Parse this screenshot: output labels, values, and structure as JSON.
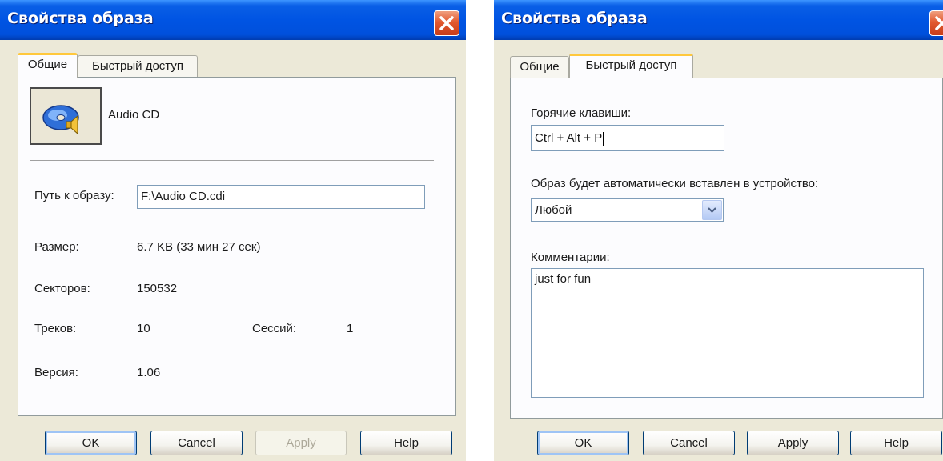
{
  "left_dialog": {
    "title": "Свойства образа",
    "tabs": [
      {
        "label": "Общие",
        "active": true
      },
      {
        "label": "Быстрый доступ",
        "active": false
      }
    ],
    "image_name": "Audio CD",
    "image_icon": "audio-cd-icon",
    "path_label": "Путь к образу:",
    "path_value": "F:\\Audio CD.cdi",
    "size_label": "Размер:",
    "size_value": "6.7 KB (33 мин 27 сек)",
    "sectors_label": "Секторов:",
    "sectors_value": "150532",
    "tracks_label": "Треков:",
    "tracks_value": "10",
    "sessions_label": "Сессий:",
    "sessions_value": "1",
    "version_label": "Версия:",
    "version_value": "1.06",
    "buttons": {
      "ok": "OK",
      "cancel": "Cancel",
      "apply": "Apply",
      "help": "Help"
    },
    "apply_enabled": false
  },
  "right_dialog": {
    "title": "Свойства образа",
    "tabs": [
      {
        "label": "Общие",
        "active": false
      },
      {
        "label": "Быстрый доступ",
        "active": true
      }
    ],
    "hotkey_label": "Горячие клавиши:",
    "hotkey_value": "Ctrl + Alt + P",
    "autoinsert_label": "Образ будет автоматически вставлен в устройство:",
    "autoinsert_selected": "Любой",
    "comments_label": "Комментарии:",
    "comments_value": "just for fun",
    "buttons": {
      "ok": "OK",
      "cancel": "Cancel",
      "apply": "Apply",
      "help": "Help"
    },
    "apply_enabled": true
  },
  "colors": {
    "titlebar": "#0054e3",
    "dialog_bg": "#ece9d8",
    "panel_bg": "#fcfcfe",
    "close_button": "#e25a30",
    "active_tab_accent": "#ffc83c"
  }
}
